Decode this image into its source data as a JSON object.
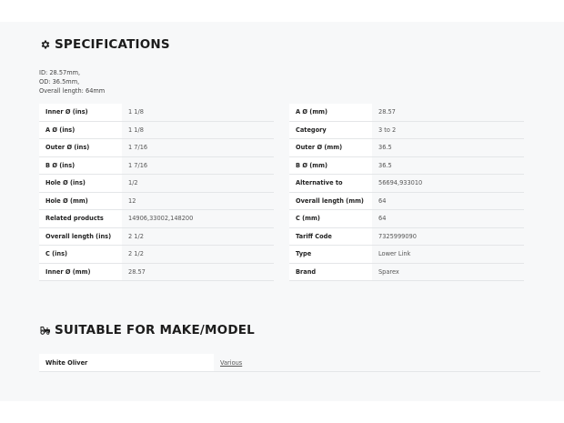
{
  "specifications": {
    "heading": "SPECIFICATIONS",
    "icon": "gear-icon",
    "description": [
      "ID: 28.57mm,",
      "OD: 36.5mm,",
      "Overall length: 64mm"
    ],
    "left_rows": [
      {
        "key": "Inner Ø (ins)",
        "value": "1 1/8"
      },
      {
        "key": "A Ø (ins)",
        "value": "1 1/8"
      },
      {
        "key": "Outer Ø (ins)",
        "value": "1 7/16"
      },
      {
        "key": "B Ø (ins)",
        "value": "1 7/16"
      },
      {
        "key": "Hole Ø (ins)",
        "value": "1/2"
      },
      {
        "key": "Hole Ø (mm)",
        "value": "12"
      },
      {
        "key": "Related products",
        "value": "14906,33002,148200"
      },
      {
        "key": "Overall length (ins)",
        "value": "2 1/2"
      },
      {
        "key": "C (ins)",
        "value": "2 1/2"
      },
      {
        "key": "Inner Ø (mm)",
        "value": "28.57"
      }
    ],
    "right_rows": [
      {
        "key": "A Ø (mm)",
        "value": "28.57"
      },
      {
        "key": "Category",
        "value": "3 to 2"
      },
      {
        "key": "Outer Ø (mm)",
        "value": "36.5"
      },
      {
        "key": "B Ø (mm)",
        "value": "36.5"
      },
      {
        "key": "Alternative to",
        "value": "56694,933010"
      },
      {
        "key": "Overall length (mm)",
        "value": "64"
      },
      {
        "key": "C (mm)",
        "value": "64"
      },
      {
        "key": "Tariff Code",
        "value": "7325999090"
      },
      {
        "key": "Type",
        "value": "Lower Link"
      },
      {
        "key": "Brand",
        "value": "Sparex"
      }
    ]
  },
  "suitable": {
    "heading": "SUITABLE FOR MAKE/MODEL",
    "icon": "tractor-icon",
    "rows": [
      {
        "make": "White Oliver",
        "model": "Various"
      }
    ]
  }
}
